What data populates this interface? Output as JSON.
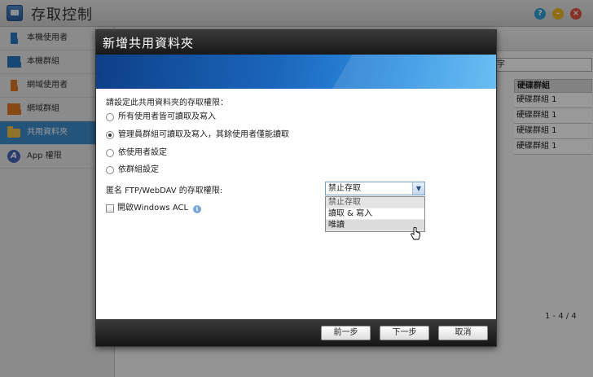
{
  "app": {
    "title": "存取控制",
    "help_icon": "question-icon",
    "minimize_icon": "minimize-icon",
    "close_icon": "close-icon"
  },
  "sidebar": {
    "items": [
      {
        "label": "本機使用者",
        "icon": "user-icon"
      },
      {
        "label": "本機群組",
        "icon": "group-icon"
      },
      {
        "label": "網域使用者",
        "icon": "domain-user-icon"
      },
      {
        "label": "網域群組",
        "icon": "domain-group-icon"
      },
      {
        "label": "共用資料夾",
        "icon": "folder-icon",
        "active": true
      },
      {
        "label": "App 權限",
        "icon": "app-icon"
      }
    ]
  },
  "main": {
    "search_value": "字",
    "table": {
      "header": "硬碟群組",
      "rows": [
        "硬碟群組 1",
        "硬碟群組 1",
        "硬碟群組 1",
        "硬碟群組 1"
      ]
    },
    "pager": "1 - 4 / 4"
  },
  "dialog": {
    "title": "新增共用資料夾",
    "prompt": "請設定此共用資料夾的存取權限：",
    "options": [
      {
        "label": "所有使用者皆可讀取及寫入",
        "checked": false
      },
      {
        "label": "管理員群組可讀取及寫入，其餘使用者僅能讀取",
        "checked": true
      },
      {
        "label": "依使用者設定",
        "checked": false
      },
      {
        "label": "依群組設定",
        "checked": false
      }
    ],
    "ftp_label": "匿名 FTP/WebDAV 的存取權限:",
    "ftp_select": {
      "value": "禁止存取",
      "options": [
        "禁止存取",
        "讀取 & 寫入",
        "唯讀"
      ]
    },
    "acl_label": "開啟Windows ACL",
    "buttons": {
      "prev": "前一步",
      "next": "下一步",
      "cancel": "取消"
    }
  }
}
